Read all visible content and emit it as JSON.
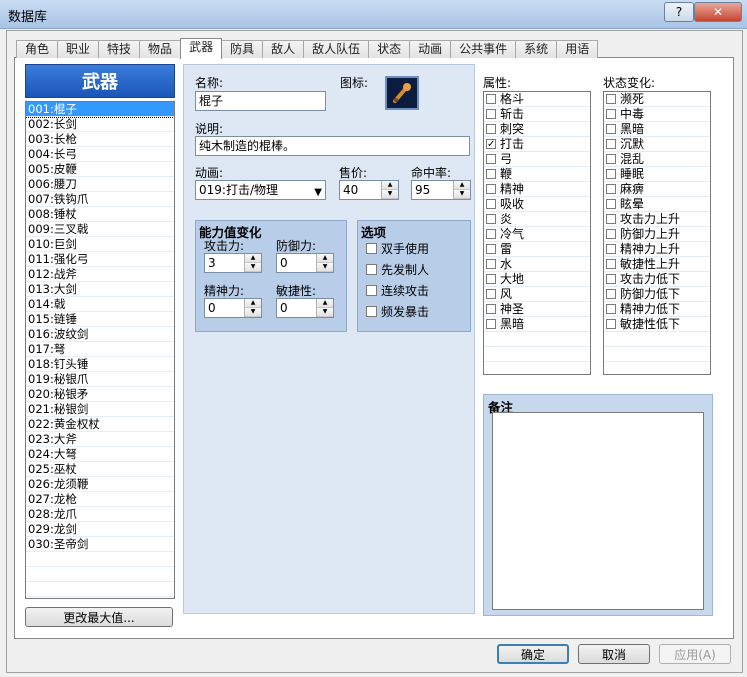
{
  "window": {
    "title": "数据库",
    "help_label": "?",
    "close_label": "✕"
  },
  "tabs": [
    {
      "label": "角色"
    },
    {
      "label": "职业"
    },
    {
      "label": "特技"
    },
    {
      "label": "物品"
    },
    {
      "label": "武器",
      "active": true
    },
    {
      "label": "防具"
    },
    {
      "label": "敌人"
    },
    {
      "label": "敌人队伍"
    },
    {
      "label": "状态"
    },
    {
      "label": "动画"
    },
    {
      "label": "公共事件"
    },
    {
      "label": "系统"
    },
    {
      "label": "用语"
    }
  ],
  "weapon_list": {
    "header": "武器",
    "items": [
      "001:棍子",
      "002:长剑",
      "003:长枪",
      "004:长弓",
      "005:皮鞭",
      "006:腰刀",
      "007:铁钩爪",
      "008:锤杖",
      "009:三叉戟",
      "010:巨剑",
      "011:强化弓",
      "012:战斧",
      "013:大剑",
      "014:戟",
      "015:链锤",
      "016:波纹剑",
      "017:弩",
      "018:钉头锤",
      "019:秘银爪",
      "020:秘银矛",
      "021:秘银剑",
      "022:黄金权杖",
      "023:大斧",
      "024:大弩",
      "025:巫杖",
      "026:龙须鞭",
      "027:龙枪",
      "028:龙爪",
      "029:龙剑",
      "030:圣帝剑"
    ],
    "selected_index": 0,
    "max_button": "更改最大值..."
  },
  "editor": {
    "name_label": "名称:",
    "name_value": "棍子",
    "icon_label": "图标:",
    "icon_name": "club-icon",
    "desc_label": "说明:",
    "desc_value": "纯木制造的棍棒。",
    "anim_label": "动画:",
    "anim_value": "019:打击/物理",
    "price_label": "售价:",
    "price_value": "40",
    "hit_label": "命中率:",
    "hit_value": "95",
    "stats": {
      "title": "能力值变化",
      "atk_label": "攻击力:",
      "atk_value": "3",
      "def_label": "防御力:",
      "def_value": "0",
      "spi_label": "精神力:",
      "spi_value": "0",
      "agi_label": "敏捷性:",
      "agi_value": "0"
    },
    "options": {
      "title": "选项",
      "items": [
        "双手使用",
        "先发制人",
        "连续攻击",
        "频发暴击"
      ]
    }
  },
  "attributes": {
    "label": "属性:",
    "items": [
      {
        "name": "格斗",
        "checked": false
      },
      {
        "name": "斩击",
        "checked": false
      },
      {
        "name": "刺突",
        "checked": false
      },
      {
        "name": "打击",
        "checked": true
      },
      {
        "name": "弓",
        "checked": false
      },
      {
        "name": "鞭",
        "checked": false
      },
      {
        "name": "精神",
        "checked": false
      },
      {
        "name": "吸收",
        "checked": false
      },
      {
        "name": "炎",
        "checked": false
      },
      {
        "name": "冷气",
        "checked": false
      },
      {
        "name": "雷",
        "checked": false
      },
      {
        "name": "水",
        "checked": false
      },
      {
        "name": "大地",
        "checked": false
      },
      {
        "name": "风",
        "checked": false
      },
      {
        "name": "神圣",
        "checked": false
      },
      {
        "name": "黑暗",
        "checked": false
      }
    ]
  },
  "states": {
    "label": "状态变化:",
    "items": [
      "濒死",
      "中毒",
      "黑暗",
      "沉默",
      "混乱",
      "睡眠",
      "麻痹",
      "眩晕",
      "攻击力上升",
      "防御力上升",
      "精神力上升",
      "敏捷性上升",
      "攻击力低下",
      "防御力低下",
      "精神力低下",
      "敏捷性低下"
    ]
  },
  "notes": {
    "label": "备注"
  },
  "footer": {
    "ok": "确定",
    "cancel": "取消",
    "apply": "应用(A)"
  }
}
